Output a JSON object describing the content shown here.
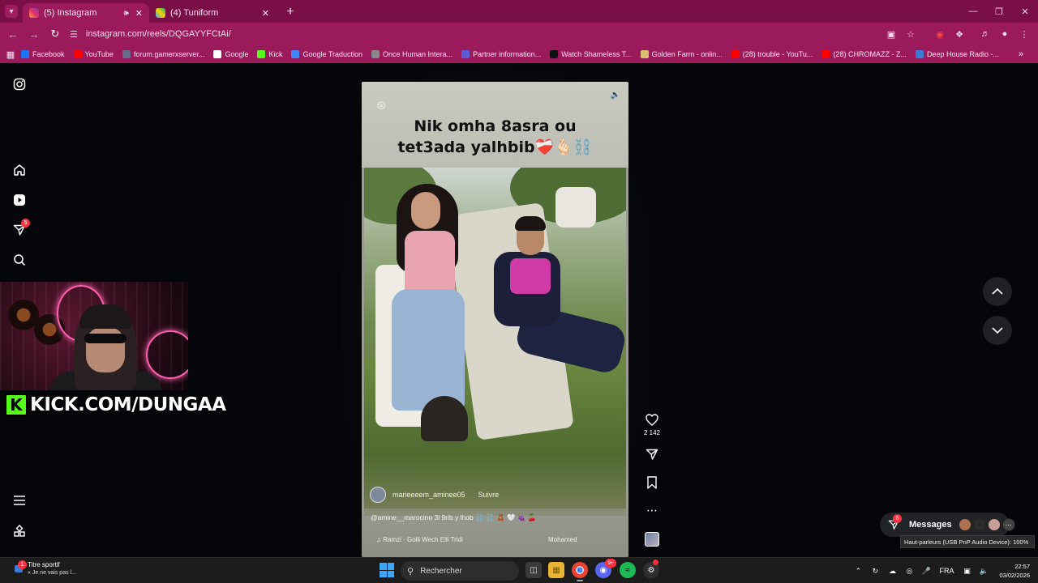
{
  "browser": {
    "tabs": [
      {
        "title": "(5) Instagram",
        "active": true,
        "favicon": "instagram-icon"
      },
      {
        "title": "(4) Tuniform",
        "active": false,
        "favicon": "tuniform-icon"
      }
    ],
    "url": "instagram.com/reels/DQGAYYFCtAi/",
    "bookmarks": [
      {
        "label": "Facebook",
        "color": "#1877f2"
      },
      {
        "label": "YouTube",
        "color": "#ff0000"
      },
      {
        "label": "forum.gamerxserver...",
        "color": "#6a6a8a"
      },
      {
        "label": "Google",
        "color": "#ffffff"
      },
      {
        "label": "Kick",
        "color": "#53fc18"
      },
      {
        "label": "Google Traduction",
        "color": "#4285f4"
      },
      {
        "label": "Once Human Intera...",
        "color": "#888888"
      },
      {
        "label": "Partner information...",
        "color": "#5b5bd6"
      },
      {
        "label": "Watch Shameless T...",
        "color": "#111111"
      },
      {
        "label": "Golden Farm - onlin...",
        "color": "#d8c070"
      },
      {
        "label": "(28) trouble - YouTu...",
        "color": "#ff0000"
      },
      {
        "label": "(28) CHROMAZZ - Z...",
        "color": "#ff0000"
      },
      {
        "label": "Deep House Radio -...",
        "color": "#3a7bd5"
      }
    ]
  },
  "stream_overlay": {
    "kick_text": "KICK.COM/DUNGAA",
    "kick_letter": "K"
  },
  "sidebar": {
    "notifications_badge": "5"
  },
  "reel": {
    "caption_line1": "Nik omha 8asra ou",
    "caption_line2": "tet3ada yalhbib❤️‍🩹🫰🏻⛓️",
    "author": "marieeeem_aminee05",
    "follow_label": "Suivre",
    "description": "@amine__marocino 3l 9rib y lhob ⛓️ ⛓️ 🧸 🤍 🍇 🍒",
    "music": "Ramzi · Golli Wech Elli Tridi",
    "music_right": "Mohamed",
    "likes": "2 142"
  },
  "messages": {
    "label": "Messages",
    "badge": "5"
  },
  "tooltip": "Haut-parleurs (USB PnP Audio Device): 100%",
  "taskbar": {
    "news_title": "Titre sportif",
    "news_sub": "« Je ne vais pas l...",
    "news_badge": "1",
    "search_placeholder": "Rechercher",
    "discord_badge": "9+",
    "lang": "FRA",
    "time": "22:57",
    "date": "03/02/2026"
  },
  "colors": {
    "tabbar": "#7a0f47",
    "toolbar": "#9a1a5c",
    "page_bg": "#05060a",
    "kick_green": "#53fc18"
  }
}
